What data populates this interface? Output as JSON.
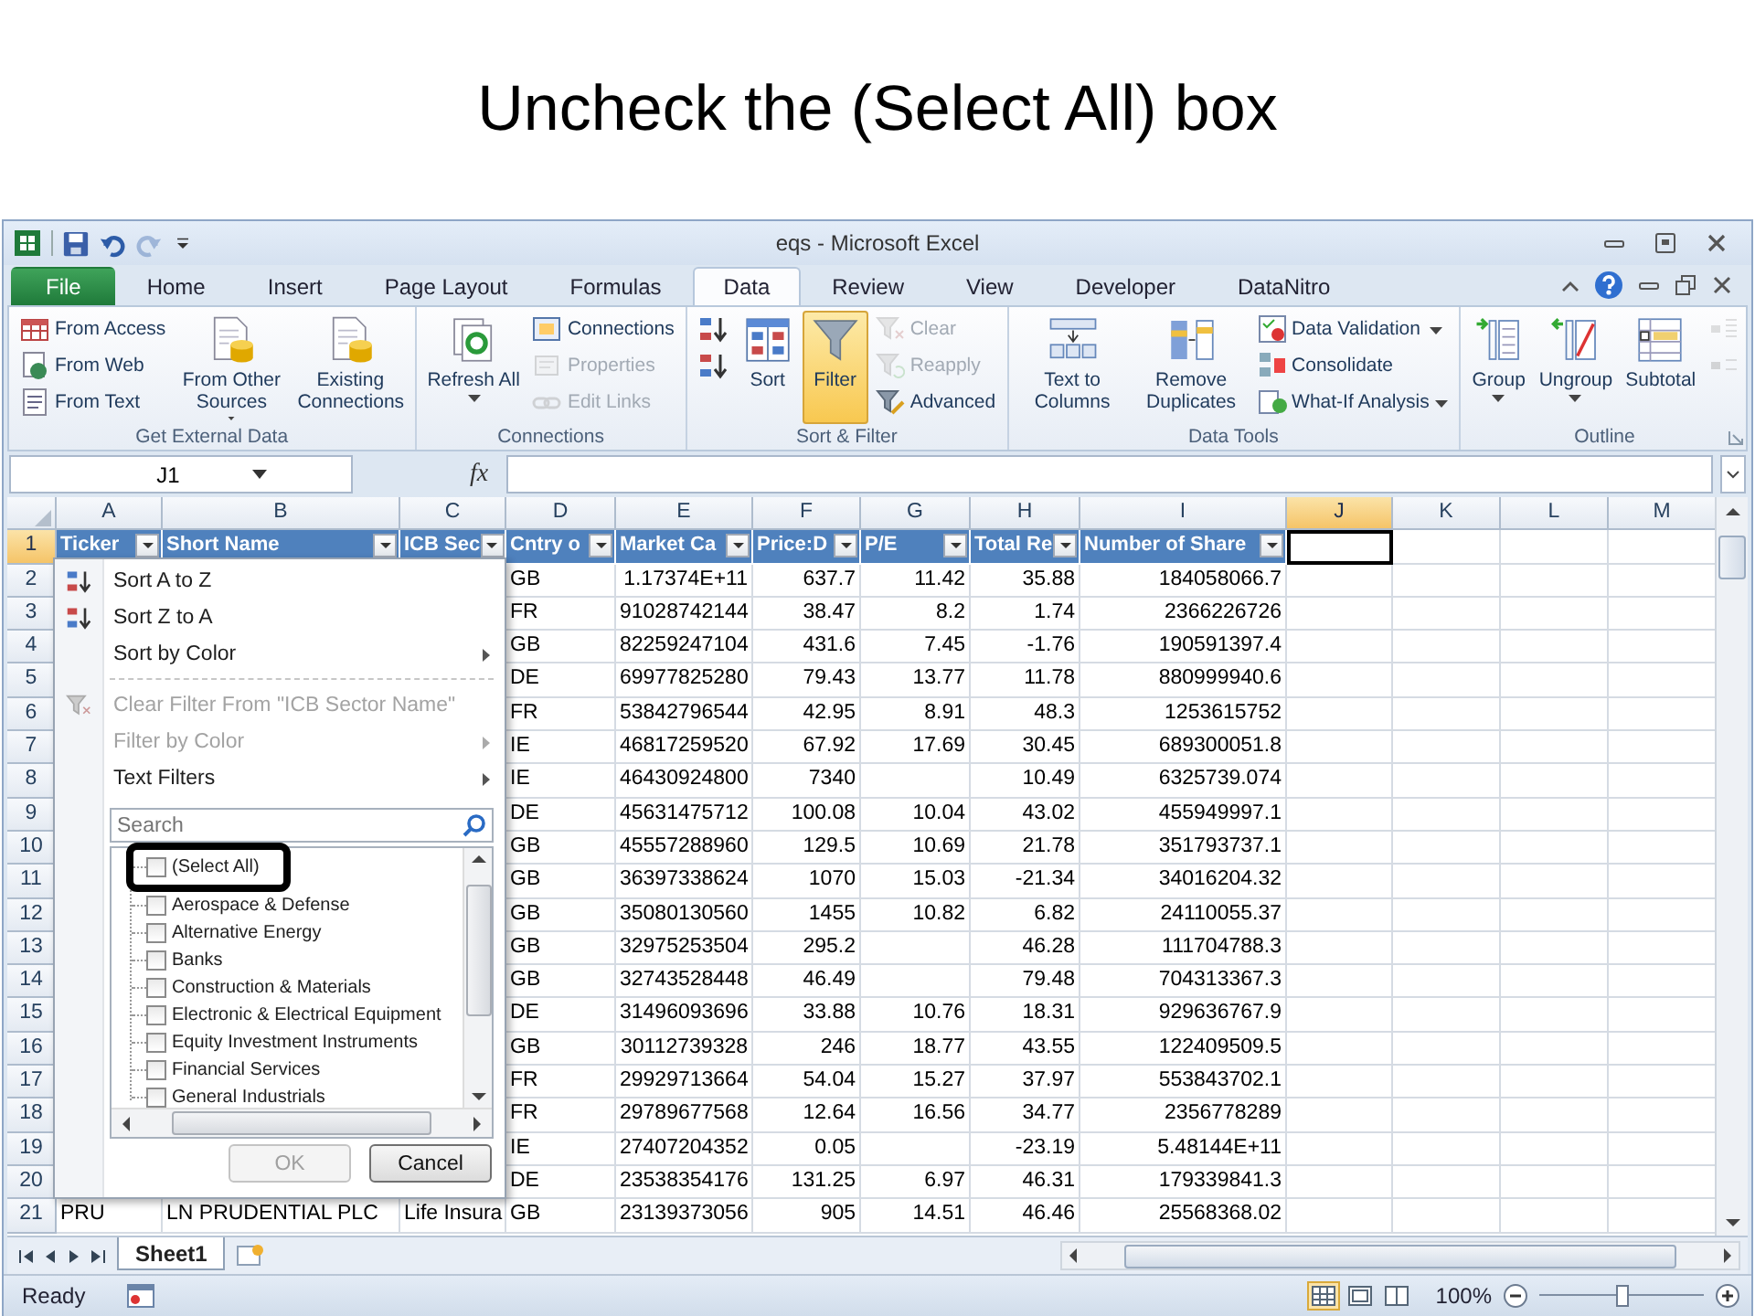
{
  "slide_title": "Uncheck the (Select All) box",
  "window": {
    "title": "eqs - Microsoft Excel"
  },
  "quick_access": [
    {
      "kind": "save",
      "disabled": false
    },
    {
      "kind": "undo",
      "disabled": false
    },
    {
      "kind": "redo",
      "disabled": true
    },
    {
      "kind": "customize",
      "disabled": false
    }
  ],
  "ribbon_tabs": [
    {
      "label": "File",
      "kind": "backstage",
      "selected": false
    },
    {
      "label": "Home",
      "kind": "tab",
      "selected": false
    },
    {
      "label": "Insert",
      "kind": "tab",
      "selected": false
    },
    {
      "label": "Page Layout",
      "kind": "tab",
      "selected": false
    },
    {
      "label": "Formulas",
      "kind": "tab",
      "selected": false
    },
    {
      "label": "Data",
      "kind": "tab",
      "selected": true
    },
    {
      "label": "Review",
      "kind": "tab",
      "selected": false
    },
    {
      "label": "View",
      "kind": "tab",
      "selected": false
    },
    {
      "label": "Developer",
      "kind": "tab",
      "selected": false
    },
    {
      "label": "DataNitro",
      "kind": "tab",
      "selected": false
    }
  ],
  "ribbon_groups": [
    {
      "label": "Get External Data",
      "items": [
        {
          "label": "From Access",
          "kind": "small",
          "disabled": false,
          "dropdown": false,
          "on": false
        },
        {
          "label": "From Web",
          "kind": "small",
          "disabled": false,
          "dropdown": false,
          "on": false
        },
        {
          "label": "From Text",
          "kind": "small",
          "disabled": false,
          "dropdown": false,
          "on": false
        },
        {
          "label": "From Other Sources",
          "kind": "large",
          "disabled": false,
          "dropdown": true,
          "on": false
        },
        {
          "label": "Existing Connections",
          "kind": "large",
          "disabled": false,
          "dropdown": false,
          "on": false
        }
      ]
    },
    {
      "label": "Connections",
      "items": [
        {
          "label": "Refresh All",
          "kind": "large",
          "disabled": false,
          "dropdown": true,
          "on": false
        },
        {
          "label": "Connections",
          "kind": "small",
          "disabled": false,
          "dropdown": false,
          "on": false
        },
        {
          "label": "Properties",
          "kind": "small",
          "disabled": true,
          "dropdown": false,
          "on": false
        },
        {
          "label": "Edit Links",
          "kind": "small",
          "disabled": true,
          "dropdown": false,
          "on": false
        }
      ]
    },
    {
      "label": "Sort & Filter",
      "items": [
        {
          "kind": "small",
          "disabled": false,
          "dropdown": false,
          "on": false
        },
        {
          "kind": "small",
          "disabled": false,
          "dropdown": false,
          "on": false
        },
        {
          "label": "Sort",
          "kind": "large",
          "disabled": false,
          "dropdown": false,
          "on": false
        },
        {
          "label": "Filter",
          "kind": "large",
          "disabled": false,
          "dropdown": false,
          "on": true
        },
        {
          "label": "Clear",
          "kind": "small",
          "disabled": true,
          "dropdown": false,
          "on": false
        },
        {
          "label": "Reapply",
          "kind": "small",
          "disabled": true,
          "dropdown": false,
          "on": false
        },
        {
          "label": "Advanced",
          "kind": "small",
          "disabled": false,
          "dropdown": false,
          "on": false
        }
      ]
    },
    {
      "label": "Data Tools",
      "items": [
        {
          "label": "Text to Columns",
          "kind": "large",
          "disabled": false,
          "dropdown": false,
          "on": false
        },
        {
          "label": "Remove Duplicates",
          "kind": "large",
          "disabled": false,
          "dropdown": false,
          "on": false
        },
        {
          "label": "Data Validation",
          "kind": "small",
          "disabled": false,
          "dropdown": true,
          "on": false
        },
        {
          "label": "Consolidate",
          "kind": "small",
          "disabled": false,
          "dropdown": false,
          "on": false
        },
        {
          "label": "What-If Analysis",
          "kind": "small",
          "disabled": false,
          "dropdown": true,
          "on": false
        }
      ]
    },
    {
      "label": "Outline",
      "launcher": true,
      "items": [
        {
          "label": "Group",
          "kind": "large",
          "disabled": false,
          "dropdown": true,
          "on": false
        },
        {
          "label": "Ungroup",
          "kind": "large",
          "disabled": false,
          "dropdown": true,
          "on": false
        },
        {
          "label": "Subtotal",
          "kind": "large",
          "disabled": false,
          "dropdown": false,
          "on": false
        },
        {
          "kind": "small",
          "disabled": true,
          "dropdown": false,
          "on": false
        },
        {
          "kind": "small",
          "disabled": true,
          "dropdown": false,
          "on": false
        }
      ]
    }
  ],
  "formula_bar": {
    "name_box": "J1",
    "function_label": "fx"
  },
  "sheet": {
    "column_letters": [
      {
        "label": "A",
        "selected": false
      },
      {
        "label": "B",
        "selected": false
      },
      {
        "label": "C",
        "selected": false
      },
      {
        "label": "D",
        "selected": false
      },
      {
        "label": "E",
        "selected": false
      },
      {
        "label": "F",
        "selected": false
      },
      {
        "label": "G",
        "selected": false
      },
      {
        "label": "H",
        "selected": false
      },
      {
        "label": "I",
        "selected": false
      },
      {
        "label": "J",
        "selected": true
      },
      {
        "label": "K",
        "selected": false
      },
      {
        "label": "L",
        "selected": false
      },
      {
        "label": "M",
        "selected": false
      }
    ],
    "columns": [
      "Ticker",
      "Short Name",
      "ICB Sec",
      "Cntry o",
      "Market Ca",
      "Price:D",
      "P/E",
      "Total Re",
      "Number of Share"
    ],
    "header_row": {
      "number": "1",
      "selected": true
    },
    "rows": [
      {
        "number": "2",
        "cells": [
          null,
          null,
          null,
          "GB",
          "1.17374E+11",
          "637.7",
          "11.42",
          "35.88",
          "184058066.7"
        ]
      },
      {
        "number": "3",
        "cells": [
          null,
          null,
          null,
          "FR",
          "91028742144",
          "38.47",
          "8.2",
          "1.74",
          "2366226726"
        ]
      },
      {
        "number": "4",
        "cells": [
          null,
          null,
          null,
          "GB",
          "82259247104",
          "431.6",
          "7.45",
          "-1.76",
          "190591397.4"
        ]
      },
      {
        "number": "5",
        "cells": [
          null,
          null,
          null,
          "DE",
          "69977825280",
          "79.43",
          "13.77",
          "11.78",
          "880999940.6"
        ]
      },
      {
        "number": "6",
        "cells": [
          null,
          null,
          null,
          "FR",
          "53842796544",
          "42.95",
          "8.91",
          "48.3",
          "1253615752"
        ]
      },
      {
        "number": "7",
        "cells": [
          null,
          null,
          null,
          "IE",
          "46817259520",
          "67.92",
          "17.69",
          "30.45",
          "689300051.8"
        ]
      },
      {
        "number": "8",
        "cells": [
          null,
          null,
          null,
          "IE",
          "46430924800",
          "7340",
          null,
          "10.49",
          "6325739.074"
        ]
      },
      {
        "number": "9",
        "cells": [
          null,
          null,
          null,
          "DE",
          "45631475712",
          "100.08",
          "10.04",
          "43.02",
          "455949997.1"
        ]
      },
      {
        "number": "10",
        "cells": [
          null,
          null,
          null,
          "GB",
          "45557288960",
          "129.5",
          "10.69",
          "21.78",
          "351793737.1"
        ]
      },
      {
        "number": "11",
        "cells": [
          null,
          null,
          null,
          "GB",
          "36397338624",
          "1070",
          "15.03",
          "-21.34",
          "34016204.32"
        ]
      },
      {
        "number": "12",
        "cells": [
          null,
          null,
          null,
          "GB",
          "35080130560",
          "1455",
          "10.82",
          "6.82",
          "24110055.37"
        ]
      },
      {
        "number": "13",
        "cells": [
          null,
          null,
          null,
          "GB",
          "32975253504",
          "295.2",
          null,
          "46.28",
          "111704788.3"
        ]
      },
      {
        "number": "14",
        "cells": [
          null,
          null,
          null,
          "GB",
          "32743528448",
          "46.49",
          null,
          "79.48",
          "704313367.3"
        ]
      },
      {
        "number": "15",
        "cells": [
          null,
          null,
          null,
          "DE",
          "31496093696",
          "33.88",
          "10.76",
          "18.31",
          "929636767.9"
        ]
      },
      {
        "number": "16",
        "cells": [
          null,
          null,
          null,
          "GB",
          "30112739328",
          "246",
          "18.77",
          "43.55",
          "122409509.5"
        ]
      },
      {
        "number": "17",
        "cells": [
          null,
          null,
          null,
          "FR",
          "29929713664",
          "54.04",
          "15.27",
          "37.97",
          "553843702.1"
        ]
      },
      {
        "number": "18",
        "cells": [
          null,
          null,
          null,
          "FR",
          "29789677568",
          "12.64",
          "16.56",
          "34.77",
          "2356778289"
        ]
      },
      {
        "number": "19",
        "cells": [
          null,
          null,
          null,
          "IE",
          "27407204352",
          "0.05",
          null,
          "-23.19",
          "5.48144E+11"
        ]
      },
      {
        "number": "20",
        "cells": [
          null,
          null,
          null,
          "DE",
          "23538354176",
          "131.25",
          "6.97",
          "46.31",
          "179339841.3"
        ]
      },
      {
        "number": "21",
        "cells": [
          "PRU",
          "LN PRUDENTIAL PLC",
          "Life Insura",
          "GB",
          "23139373056",
          "905",
          "14.51",
          "46.46",
          "25568368.02"
        ]
      }
    ]
  },
  "filter_menu": {
    "items": [
      {
        "kind": "command",
        "label": "Sort A to Z",
        "disabled": false,
        "submenu": false
      },
      {
        "kind": "command",
        "label": "Sort Z to A",
        "disabled": false,
        "submenu": false
      },
      {
        "kind": "command",
        "label": "Sort by Color",
        "disabled": false,
        "submenu": true
      },
      {
        "kind": "separator"
      },
      {
        "kind": "command",
        "label": "Clear Filter From \"ICB Sector Name\"",
        "disabled": true,
        "submenu": false
      },
      {
        "kind": "command",
        "label": "Filter by Color",
        "disabled": true,
        "submenu": true
      },
      {
        "kind": "command",
        "label": "Text Filters",
        "disabled": false,
        "submenu": true
      }
    ],
    "search": {
      "placeholder": "Search"
    },
    "values": [
      {
        "label": "(Select All)",
        "checked": false,
        "highlighted": true
      },
      {
        "label": "Aerospace & Defense",
        "checked": false,
        "highlighted": false
      },
      {
        "label": "Alternative Energy",
        "checked": false,
        "highlighted": false
      },
      {
        "label": "Banks",
        "checked": false,
        "highlighted": false
      },
      {
        "label": "Construction & Materials",
        "checked": false,
        "highlighted": false
      },
      {
        "label": "Electronic & Electrical Equipment",
        "checked": false,
        "highlighted": false
      },
      {
        "label": "Equity Investment Instruments",
        "checked": false,
        "highlighted": false
      },
      {
        "label": "Financial Services",
        "checked": false,
        "highlighted": false
      },
      {
        "label": "General Industrials",
        "checked": false,
        "highlighted": false
      }
    ],
    "buttons": [
      {
        "label": "OK",
        "disabled": true
      },
      {
        "label": "Cancel",
        "disabled": false
      }
    ]
  },
  "sheet_tabs": [
    {
      "label": "Sheet1",
      "selected": true
    }
  ],
  "status_bar": {
    "text": "Ready",
    "views": [
      {
        "kind": "normal",
        "selected": true
      },
      {
        "kind": "page_layout",
        "selected": false
      },
      {
        "kind": "page_break",
        "selected": false
      }
    ],
    "zoom": {
      "label": "100%",
      "level": 0.5
    }
  }
}
